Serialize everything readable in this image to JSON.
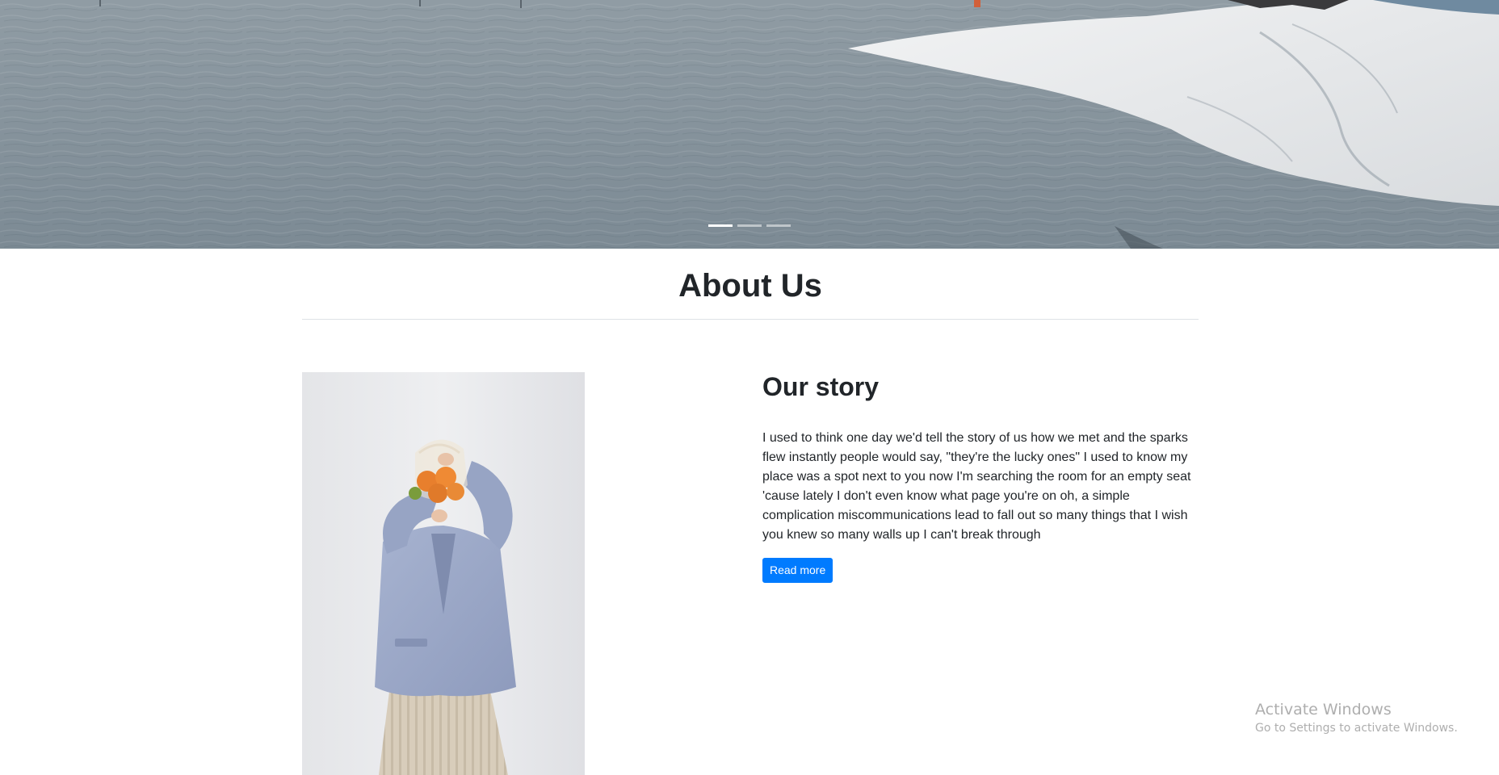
{
  "hero": {
    "slide_count": 3,
    "active_slide": 1
  },
  "about": {
    "title": "About Us"
  },
  "story": {
    "title": "Our story",
    "text": "I used to think one day we'd tell the story of us how we met and the sparks flew instantly people would say, \"they're the lucky ones\" I used to know my place was a spot next to you now I'm searching the room for an empty seat 'cause lately I don't even know what page you're on oh, a simple complication miscommunications lead to fall out so many things that I wish you knew so many walls up I can't break through",
    "button_label": "Read more"
  },
  "watermark": {
    "title": "Activate Windows",
    "subtitle": "Go to Settings to activate Windows."
  },
  "colors": {
    "primary": "#007bff",
    "heading": "#212529",
    "divider": "#dee2e6"
  }
}
